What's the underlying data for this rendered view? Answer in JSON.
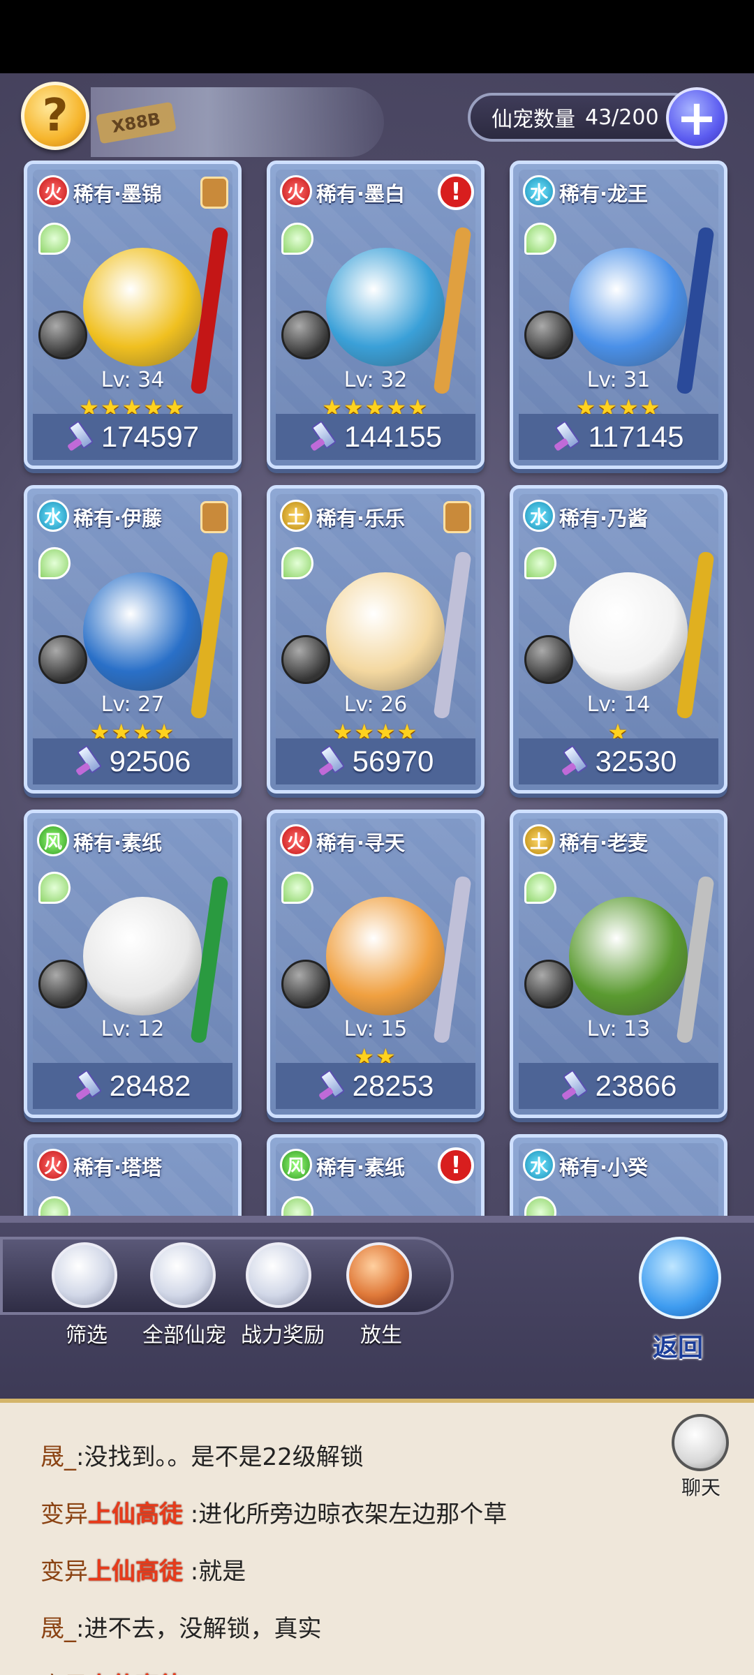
{
  "header": {
    "banner_tag": "X88B",
    "pet_count_label": "仙宠数量",
    "pet_count_value": "43/200"
  },
  "pets": [
    {
      "element": "fire",
      "name": "稀有·墨锦",
      "badge": "lock",
      "level": "Lv: 34",
      "stars": 5,
      "power": "174597",
      "pet_color": "#f0c020",
      "weapon_color": "#c41616"
    },
    {
      "element": "fire",
      "name": "稀有·墨白",
      "badge": "alert",
      "level": "Lv: 32",
      "stars": 5,
      "power": "144155",
      "pet_color": "#3aa0d8",
      "weapon_color": "#e0a040"
    },
    {
      "element": "water",
      "name": "稀有·龙王",
      "badge": "none",
      "level": "Lv: 31",
      "stars": 4,
      "power": "117145",
      "pet_color": "#4a90e8",
      "weapon_color": "#2a4a9a"
    },
    {
      "element": "water",
      "name": "稀有·伊藤",
      "badge": "lock",
      "level": "Lv: 27",
      "stars": 4,
      "power": "92506",
      "pet_color": "#2a70c8",
      "weapon_color": "#e0b020"
    },
    {
      "element": "earth",
      "name": "稀有·乐乐",
      "badge": "lock",
      "level": "Lv: 26",
      "stars": 4,
      "power": "56970",
      "pet_color": "#f4d8a0",
      "weapon_color": "#c0c0d8"
    },
    {
      "element": "water",
      "name": "稀有·乃酱",
      "badge": "none",
      "level": "Lv: 14",
      "stars": 1,
      "power": "32530",
      "pet_color": "#f2f2f2",
      "weapon_color": "#e0b020"
    },
    {
      "element": "wind",
      "name": "稀有·素纸",
      "badge": "none",
      "level": "Lv: 12",
      "stars": 0,
      "power": "28482",
      "pet_color": "#e8e8e8",
      "weapon_color": "#2a9a40"
    },
    {
      "element": "fire",
      "name": "稀有·寻天",
      "badge": "none",
      "level": "Lv: 15",
      "stars": 2,
      "power": "28253",
      "pet_color": "#f0a040",
      "weapon_color": "#c0c0d8"
    },
    {
      "element": "earth",
      "name": "稀有·老麦",
      "badge": "none",
      "level": "Lv: 13",
      "stars": 0,
      "power": "23866",
      "pet_color": "#5a9a30",
      "weapon_color": "#c0c0c0"
    },
    {
      "element": "fire",
      "name": "稀有·塔塔",
      "badge": "none",
      "level": "",
      "stars": 0,
      "power": "",
      "pet_color": "",
      "weapon_color": ""
    },
    {
      "element": "wind",
      "name": "稀有·素纸",
      "badge": "alert",
      "level": "",
      "stars": 0,
      "power": "",
      "pet_color": "",
      "weapon_color": ""
    },
    {
      "element": "water",
      "name": "稀有·小癸",
      "badge": "none",
      "level": "",
      "stars": 0,
      "power": "",
      "pet_color": "",
      "weapon_color": ""
    }
  ],
  "element_glyphs": {
    "fire": "火",
    "water": "水",
    "earth": "土",
    "wind": "风"
  },
  "toolbar": {
    "filter_label": "筛选",
    "all_pets_label": "全部仙宠",
    "power_reward_label": "战力奖励",
    "release_label": "放生",
    "back_label": "返回"
  },
  "chat": {
    "icon_label": "聊天",
    "messages": [
      {
        "prefix": "",
        "user": "晟_",
        "title": "",
        "text": ":没找到。。是不是22级解锁"
      },
      {
        "prefix": "变异",
        "user": "",
        "title": "上仙高徒",
        "text": " :进化所旁边晾衣架左边那个草"
      },
      {
        "prefix": "变异",
        "user": "",
        "title": "上仙高徒",
        "text": " :就是"
      },
      {
        "prefix": "",
        "user": "晟_",
        "title": "",
        "text": ":进不去，没解锁，真实"
      },
      {
        "prefix": "变异",
        "user": "",
        "title": "上仙高徒",
        "text": " :。。"
      }
    ]
  }
}
